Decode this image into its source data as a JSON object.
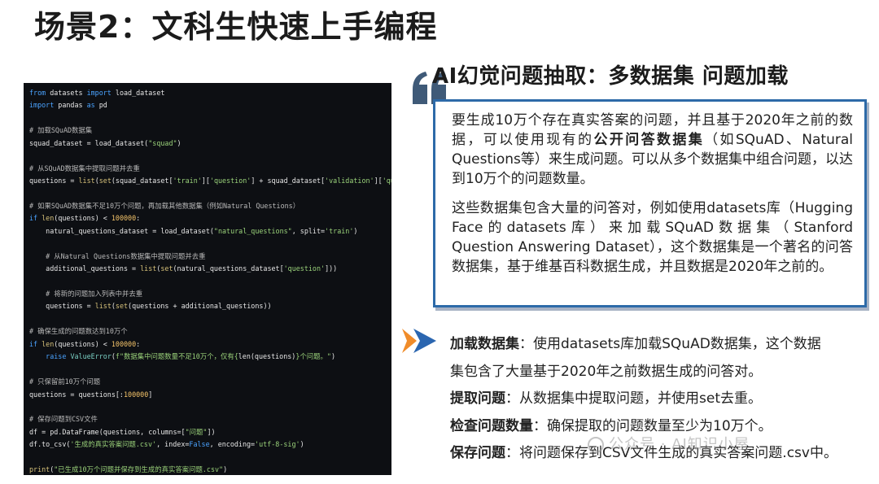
{
  "slide": {
    "title": "场景2：文科生快速上手编程"
  },
  "section": {
    "heading": "AI幻觉问题抽取：多数据集 问题加载"
  },
  "code": {
    "lines": [
      [
        [
          "kw",
          "from"
        ],
        [
          "t",
          " datasets "
        ],
        [
          "kw",
          "import"
        ],
        [
          "t",
          " load_dataset"
        ]
      ],
      [
        [
          "kw",
          "import"
        ],
        [
          "t",
          " pandas "
        ],
        [
          "kw",
          "as"
        ],
        [
          "t",
          " pd"
        ]
      ],
      [],
      [
        [
          "cm",
          "# 加载SQuAD数据集"
        ]
      ],
      [
        [
          "t",
          "squad_dataset = load_dataset("
        ],
        [
          "str",
          "\"squad\""
        ],
        [
          "t",
          ")"
        ]
      ],
      [],
      [
        [
          "cm",
          "# 从SQuAD数据集中提取问题并去重"
        ]
      ],
      [
        [
          "t",
          "questions = "
        ],
        [
          "fn",
          "list"
        ],
        [
          "t",
          "("
        ],
        [
          "fn",
          "set"
        ],
        [
          "t",
          "(squad_dataset["
        ],
        [
          "str",
          "'train'"
        ],
        [
          "t",
          "]["
        ],
        [
          "str",
          "'question'"
        ],
        [
          "t",
          "] + squad_dataset["
        ],
        [
          "str",
          "'validation'"
        ],
        [
          "t",
          "]["
        ],
        [
          "str",
          "'que"
        ]
      ],
      [],
      [
        [
          "cm",
          "# 如果SQuAD数据集不足10万个问题，再加载其他数据集（例如Natural Questions）"
        ]
      ],
      [
        [
          "kw",
          "if"
        ],
        [
          "t",
          " "
        ],
        [
          "fn",
          "len"
        ],
        [
          "t",
          "(questions) < "
        ],
        [
          "num",
          "100000"
        ],
        [
          "t",
          ":"
        ]
      ],
      [
        [
          "t",
          "    natural_questions_dataset = load_dataset("
        ],
        [
          "str",
          "\"natural_questions\""
        ],
        [
          "t",
          ", split="
        ],
        [
          "str",
          "'train'"
        ],
        [
          "t",
          ")"
        ]
      ],
      [],
      [
        [
          "cm",
          "    # 从Natural Questions数据集中提取问题并去重"
        ]
      ],
      [
        [
          "t",
          "    additional_questions = "
        ],
        [
          "fn",
          "list"
        ],
        [
          "t",
          "("
        ],
        [
          "fn",
          "set"
        ],
        [
          "t",
          "(natural_questions_dataset["
        ],
        [
          "str",
          "'question'"
        ],
        [
          "t",
          "]))"
        ]
      ],
      [],
      [
        [
          "cm",
          "    # 将新的问题加入列表中并去重"
        ]
      ],
      [
        [
          "t",
          "    questions = "
        ],
        [
          "fn",
          "list"
        ],
        [
          "t",
          "("
        ],
        [
          "fn",
          "set"
        ],
        [
          "t",
          "(questions + additional_questions))"
        ]
      ],
      [],
      [
        [
          "cm",
          "# 确保生成的问题数达到10万个"
        ]
      ],
      [
        [
          "kw",
          "if"
        ],
        [
          "t",
          " "
        ],
        [
          "fn",
          "len"
        ],
        [
          "t",
          "(questions) < "
        ],
        [
          "num",
          "100000"
        ],
        [
          "t",
          ":"
        ]
      ],
      [
        [
          "t",
          "    "
        ],
        [
          "kw",
          "raise"
        ],
        [
          "t",
          " "
        ],
        [
          "err",
          "ValueError"
        ],
        [
          "t",
          "("
        ],
        [
          "str",
          "f\"数据集中问题数量不足10万个，仅有{"
        ],
        [
          "t",
          "len(questions)"
        ],
        [
          "str",
          "}个问题。\""
        ],
        [
          "t",
          ")"
        ]
      ],
      [],
      [
        [
          "cm",
          "# 只保留前10万个问题"
        ]
      ],
      [
        [
          "t",
          "questions = questions[:"
        ],
        [
          "num",
          "100000"
        ],
        [
          "t",
          "]"
        ]
      ],
      [],
      [
        [
          "cm",
          "# 保存问题到CSV文件"
        ]
      ],
      [
        [
          "t",
          "df = pd.DataFrame(questions, columns=["
        ],
        [
          "str",
          "\"问题\""
        ],
        [
          "t",
          "])"
        ]
      ],
      [
        [
          "t",
          "df.to_csv("
        ],
        [
          "str",
          "'生成的真实答案问题.csv'"
        ],
        [
          "t",
          ", index="
        ],
        [
          "kw",
          "False"
        ],
        [
          "t",
          ", encoding="
        ],
        [
          "str",
          "'utf-8-sig'"
        ],
        [
          "t",
          ")"
        ]
      ],
      [],
      [
        [
          "fn",
          "print"
        ],
        [
          "t",
          "("
        ],
        [
          "str",
          "\"已生成10万个问题并保存到生成的真实答案问题.csv\""
        ],
        [
          "t",
          ")"
        ]
      ]
    ]
  },
  "quote": {
    "p1_a": "要生成10万个存在真实答案的问题，并且基于2020年之前的数据，可以使用现有的",
    "p1_bold": "公开问答数据集",
    "p1_b": "（如SQuAD、Natural Questions等）来生成问题。可以从多个数据集中组合问题，以达到10万个的问题数量。",
    "p2": "这些数据集包含大量的问答对，例如使用datasets库（Hugging Face的datasets库）来加载SQuAD数据集（Stanford Question Answering Dataset），这个数据集是一个著名的问答数据集，基于维基百科数据生成，并且数据是2020年之前的。"
  },
  "bullets": {
    "b1_label": "加载数据集",
    "b1_text_1": "：使用datasets库加载SQuAD数据集，这个数据",
    "b1_text_2": "集包含了大量基于2020年之前数据生成的问答对。",
    "b2_label": "提取问题",
    "b2_text": "：从数据集中提取问题，并使用set去重。",
    "b3_label": "检查问题数量",
    "b3_text": "：确保提取的问题数量至少为10万个。",
    "b4_label": "保存问题",
    "b4_text": "：将问题保存到CSV文件生成的真实答案问题.csv中。"
  },
  "watermark": {
    "text": "公众号 · AI知识小屋"
  },
  "colors": {
    "accent_blue": "#2d6aa8",
    "arrow_orange": "#f08c2a",
    "arrow_blue": "#2b66b0",
    "code_bg": "#0d0f13"
  },
  "icons": {
    "quote": "quote-mark-icon",
    "arrow": "double-chevron-arrow-icon"
  }
}
